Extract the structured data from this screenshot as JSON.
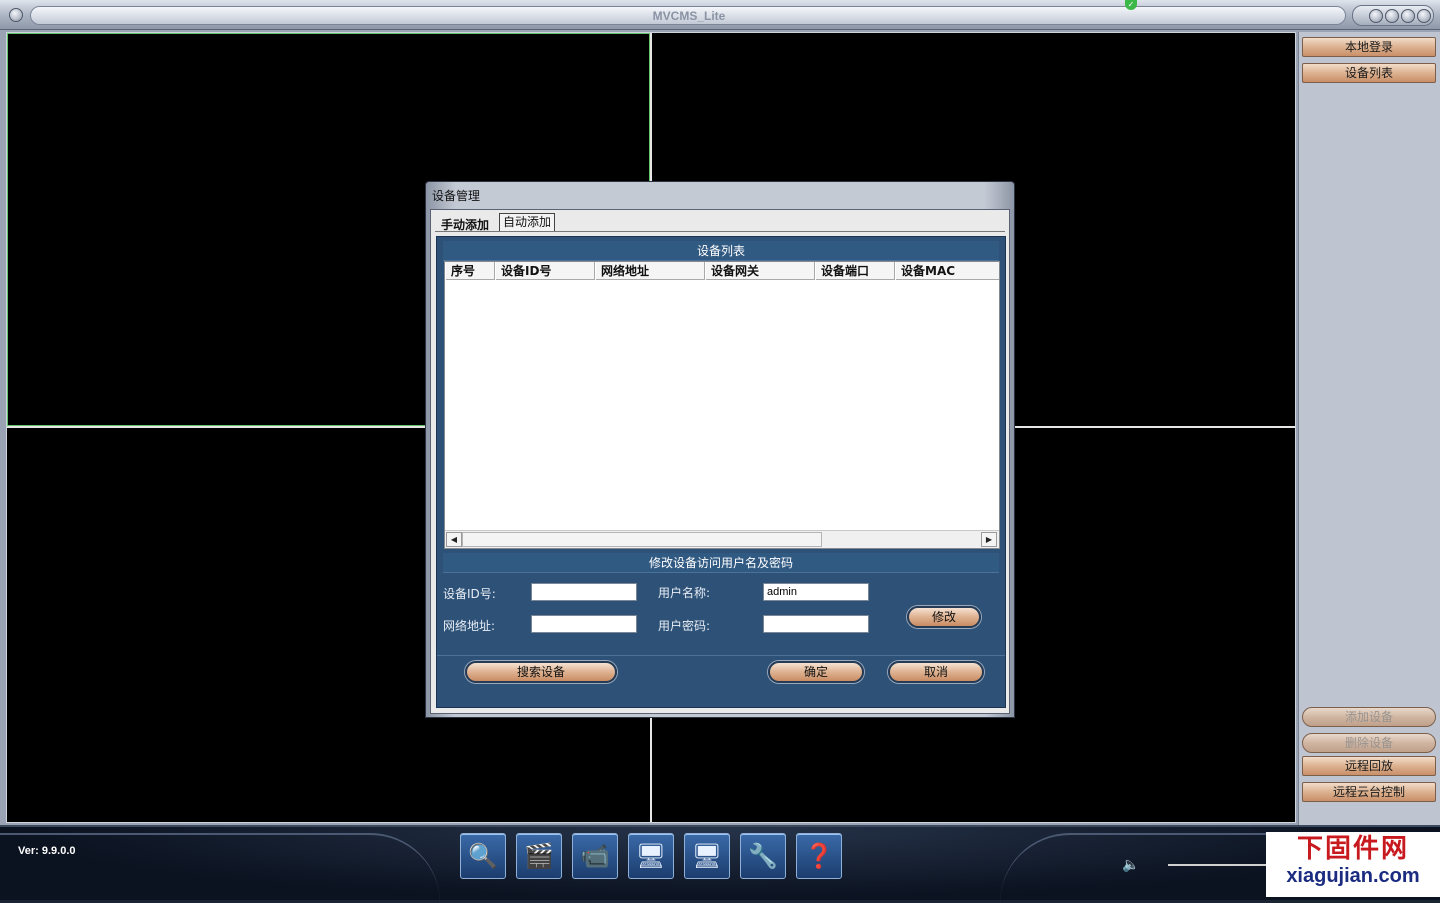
{
  "window": {
    "title": "MVCMS_Lite",
    "controls": [
      "◎",
      "◎",
      "◎",
      "◎"
    ]
  },
  "right_panel": {
    "top_buttons": [
      {
        "label": "本地登录"
      },
      {
        "label": "设备列表"
      }
    ],
    "bottom_buttons": [
      {
        "label": "添加设备",
        "enabled": false
      },
      {
        "label": "删除设备",
        "enabled": false
      },
      {
        "label": "远程回放",
        "enabled": true
      },
      {
        "label": "远程云台控制",
        "enabled": true
      }
    ]
  },
  "bottom_bar": {
    "version": "Ver: 9.9.0.0",
    "tools": [
      {
        "icon": "search-icon",
        "glyph": "🔍"
      },
      {
        "icon": "clapperboard-icon",
        "glyph": "🎬"
      },
      {
        "icon": "camera-icon",
        "glyph": "📹"
      },
      {
        "icon": "monitor-icon",
        "glyph": "🖥"
      },
      {
        "icon": "display-settings-icon",
        "glyph": "🖥"
      },
      {
        "icon": "tools-icon",
        "glyph": "🔧"
      },
      {
        "icon": "help-icon",
        "glyph": "❓"
      }
    ],
    "volume_icon": "🔈",
    "watermark": {
      "cn": "下固件网",
      "en": "xiagujian.com"
    }
  },
  "dialog": {
    "title": "设备管理",
    "tabs": [
      {
        "label": "手动添加",
        "active": false
      },
      {
        "label": "自动添加",
        "active": true
      }
    ],
    "list_section": {
      "title": "设备列表",
      "columns": [
        "序号",
        "设备ID号",
        "网络地址",
        "设备网关",
        "设备端口",
        "设备MAC"
      ],
      "rows": []
    },
    "credentials_section": {
      "title": "修改设备访问用户名及密码",
      "device_id_label": "设备ID号:",
      "device_id_value": "",
      "address_label": "网络地址:",
      "address_value": "",
      "username_label": "用户名称:",
      "username_value": "admin",
      "password_label": "用户密码:",
      "password_value": "",
      "modify_button": "修改"
    },
    "buttons": {
      "search": "搜索设备",
      "ok": "确定",
      "cancel": "取消"
    }
  },
  "colors": {
    "dialog_panel": "#2e5277",
    "active_pane_border": "#62c36b",
    "button_fill": "#e0b696"
  }
}
